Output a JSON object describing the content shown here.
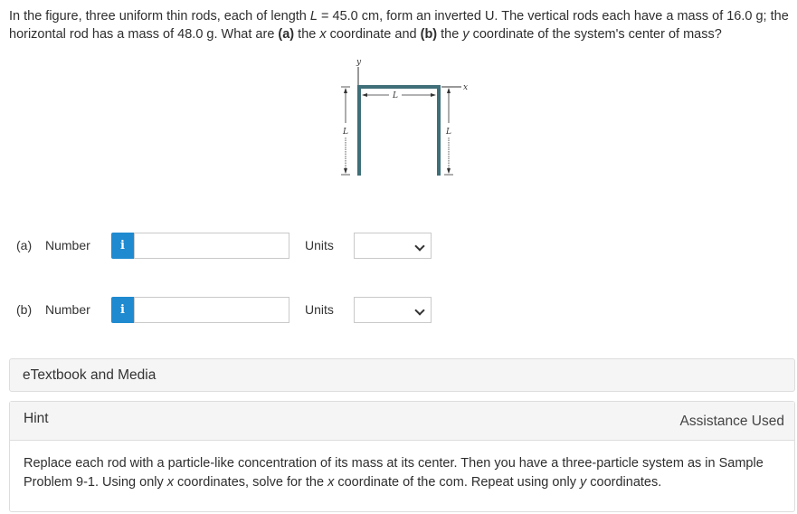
{
  "question": {
    "t1": "In the figure, three uniform thin rods, each of length ",
    "L": "L",
    "t2": " = 45.0 cm, form an inverted U. The vertical rods each have a mass of 16.0 g; the horizontal rod has a mass of 48.0 g. What are ",
    "a": "(a)",
    "t3": " the ",
    "x": "x",
    "t4": " coordinate and ",
    "b": "(b)",
    "t5": " the ",
    "y": "y",
    "t6": " coordinate of the system's center of mass?"
  },
  "figure": {
    "y_axis": "y",
    "x_axis": "x",
    "top_label": "L",
    "left_label": "L",
    "right_label": "L"
  },
  "answers": [
    {
      "part": "(a)",
      "label": "Number",
      "info": "i",
      "value": "",
      "units_label": "Units",
      "units_value": ""
    },
    {
      "part": "(b)",
      "label": "Number",
      "info": "i",
      "value": "",
      "units_label": "Units",
      "units_value": ""
    }
  ],
  "etextbook": {
    "label": "eTextbook and Media"
  },
  "hint": {
    "title": "Hint",
    "assistance": "Assistance Used",
    "b1": "Replace each rod with a particle-like concentration of its mass at its center. Then you have a three-particle system as in Sample Problem 9-1. Using only ",
    "x1": "x",
    "b2": " coordinates, solve for the ",
    "x2": "x",
    "b3": " coordinate of the com. Repeat using only ",
    "y1": "y",
    "b4": " coordinates."
  },
  "colors": {
    "info_button": "#1f8ad0",
    "rod": "#3f6f78"
  }
}
